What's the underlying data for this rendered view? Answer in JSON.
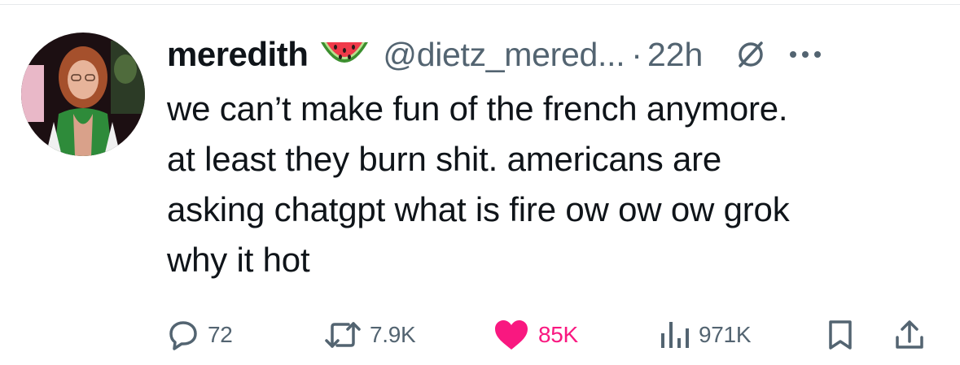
{
  "tweet": {
    "author": {
      "display_name": "meredith",
      "handle": "@dietz_mered...",
      "badge_icon": "watermelon-icon",
      "avatar_icon": "profile-photo"
    },
    "separator": "·",
    "timestamp": "22h",
    "text": "we can’t make fun of the french anymore.\nat least they burn shit. americans are\nasking chatgpt what is fire ow ow ow grok\nwhy it hot",
    "actions": {
      "replies": "72",
      "reposts": "7.9K",
      "likes": "85K",
      "views": "971K",
      "liked": true
    }
  },
  "colors": {
    "text": "#0f1419",
    "secondary": "#536471",
    "like": "#f91880"
  }
}
